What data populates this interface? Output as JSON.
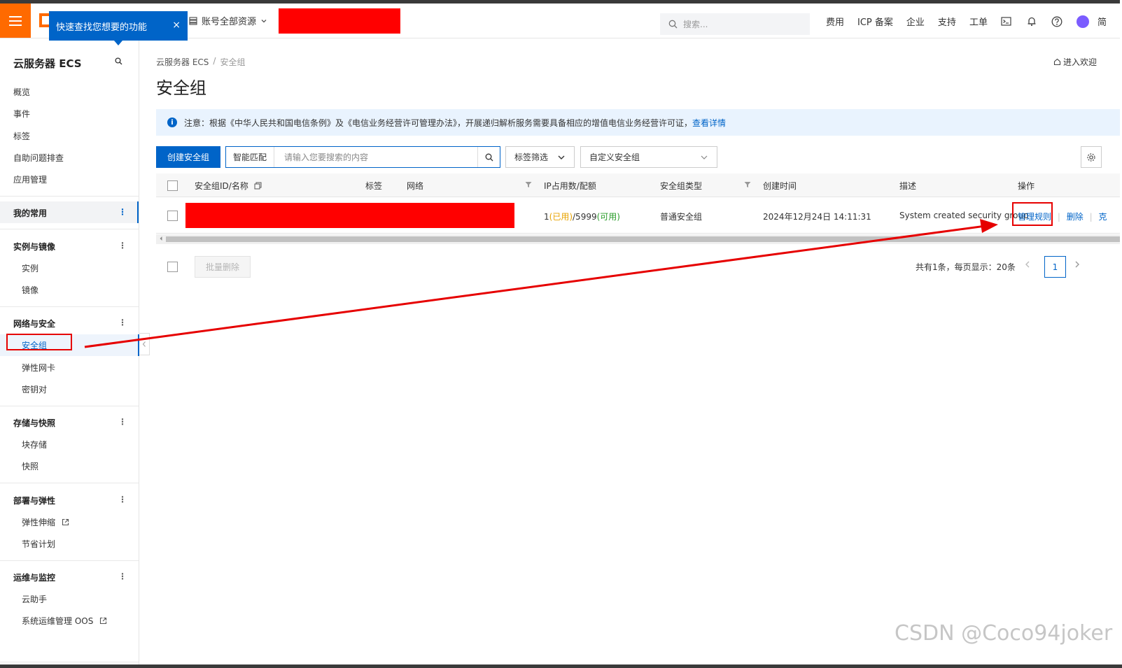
{
  "header": {
    "tooltip_text": "快速查找您想要的功能",
    "tooltip_close": "×",
    "account_selector": "账号全部资源",
    "search_placeholder": "搜索...",
    "links": [
      "费用",
      "ICP 备案",
      "企业",
      "支持",
      "工单"
    ],
    "cut_link": "简"
  },
  "sidebar": {
    "title": "云服务器 ECS",
    "top_items": [
      "概览",
      "事件",
      "标签",
      "自助问题排查",
      "应用管理"
    ],
    "favorites": "我的常用",
    "groups": [
      {
        "label": "实例与镜像",
        "items": [
          "实例",
          "镜像"
        ]
      },
      {
        "label": "网络与安全",
        "items": [
          "安全组",
          "弹性网卡",
          "密钥对"
        ]
      },
      {
        "label": "存储与快照",
        "items": [
          "块存储",
          "快照"
        ]
      },
      {
        "label": "部署与弹性",
        "items": [
          "弹性伸缩",
          "节省计划"
        ]
      },
      {
        "label": "运维与监控",
        "items": [
          "云助手",
          "系统运维管理 OOS"
        ]
      }
    ],
    "dots": "⋮"
  },
  "main": {
    "breadcrumb": [
      "云服务器 ECS",
      "/",
      "安全组"
    ],
    "welcome_link": "进入欢迎",
    "title": "安全组",
    "notice": {
      "text": "注意：根据《中华人民共和国电信条例》及《电信业务经营许可管理办法》，开展递归解析服务需要具备相应的增值电信业务经营许可证，",
      "link": "查看详情"
    },
    "toolbar": {
      "create_button": "创建安全组",
      "match_label": "智能匹配",
      "search_placeholder": "请输入您要搜索的内容",
      "tag_filter": "标签筛选",
      "custom_filter": "自定义安全组"
    },
    "table": {
      "headers": [
        "安全组ID/名称",
        "标签",
        "网络",
        "IP占用数/配额",
        "安全组类型",
        "创建时间",
        "描述",
        "操作"
      ],
      "row": {
        "ip_used": "1",
        "ip_used_tag": "(已用)",
        "ip_quota": "/5999",
        "ip_avail_tag": "(可用)",
        "type": "普通安全组",
        "created": "2024年12月24日 14:11:31",
        "description": "System created security group",
        "actions": [
          "管理规则",
          "删除",
          "克"
        ],
        "action_sep": "|"
      }
    },
    "bulk_delete": "批量删除",
    "pagination": {
      "info": "共有1条，每页显示：20条",
      "current_page": "1"
    }
  },
  "watermark": "CSDN @Coco94joker",
  "colors": {
    "brand": "#ff6a00",
    "primary": "#0064c8",
    "annotation": "#e60000",
    "redaction": "#ff0000"
  }
}
